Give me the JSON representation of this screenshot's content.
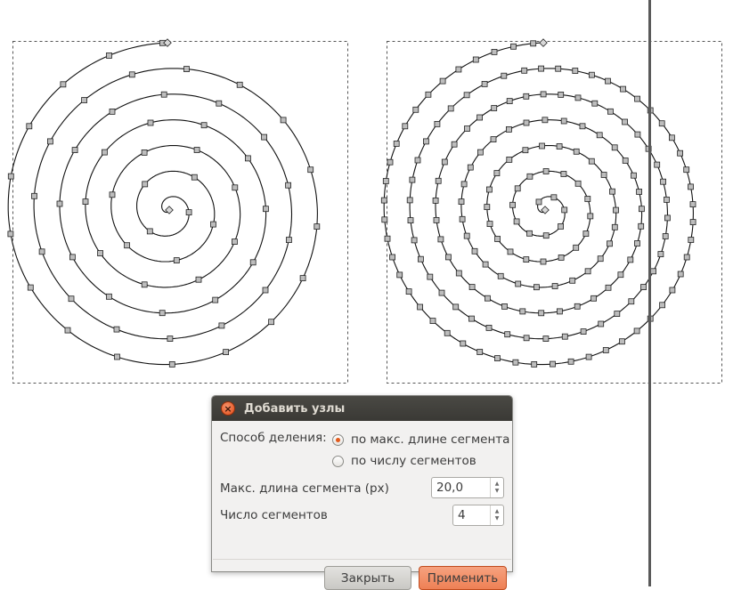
{
  "canvas": {
    "left_spiral": {
      "label": "spiral-original",
      "node_style": "sparse"
    },
    "right_spiral": {
      "label": "spiral-with-added-nodes",
      "node_style": "dense"
    }
  },
  "dialog": {
    "title": "Добавить узлы",
    "method_label": "Способ деления:",
    "options": [
      {
        "label": "по макс. длине сегмента",
        "selected": true
      },
      {
        "label": "по числу сегментов",
        "selected": false
      }
    ],
    "max_length_label": "Макс. длина сегмента (px)",
    "max_length_value": "20,0",
    "segments_label": "Число сегментов",
    "segments_value": "4",
    "close_button": "Закрыть",
    "apply_button": "Применить"
  },
  "colors": {
    "accent": "#ee8055",
    "titlebar": "#3c3b37",
    "dialog_bg": "#f2f1f0"
  }
}
